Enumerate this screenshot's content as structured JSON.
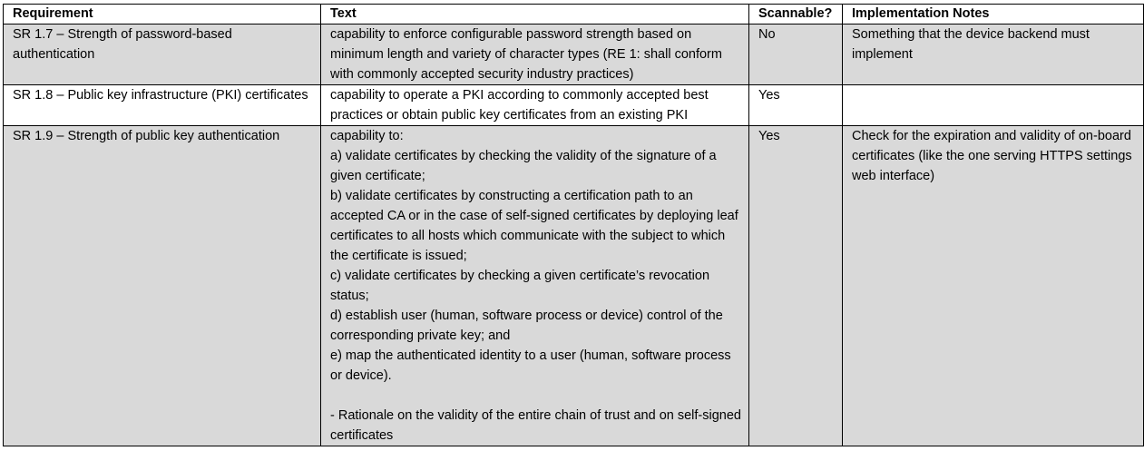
{
  "table": {
    "headers": [
      "Requirement",
      "Text",
      "Scannable?",
      "Implementation Notes"
    ],
    "rows": [
      {
        "requirement": "SR 1.7 – Strength of password-based authentication",
        "text": "capability to enforce configurable password strength based on minimum length and variety of character types (RE 1: shall conform with commonly accepted security industry practices)",
        "scannable": "No",
        "notes": "Something that the device backend must implement"
      },
      {
        "requirement": "SR 1.8 – Public key infrastructure (PKI) certificates",
        "text": "capability to operate a PKI according to commonly accepted best practices or obtain public key certificates from an existing PKI",
        "scannable": "Yes",
        "notes": ""
      },
      {
        "requirement": "SR 1.9 – Strength of public key authentication",
        "text_lines": [
          "capability to:",
          "a) validate certificates by checking the validity of the signature of a given certificate;",
          "b) validate certificates by constructing a certification path to an accepted CA or in the case of self-signed certificates by deploying leaf certificates to all hosts which communicate with the subject to which the certificate is issued;",
          "c) validate certificates by checking a given certificate’s revocation status;",
          "d) establish user (human, software process or device) control of the corresponding private key; and",
          "e) map the authenticated identity to a user (human, software process or device).",
          "- Rationale on the validity of the entire chain of trust and on self-signed certificates"
        ],
        "scannable": "Yes",
        "notes": "Check for the expiration and validity of on-board certificates (like the one serving HTTPS settings web interface)"
      }
    ]
  }
}
